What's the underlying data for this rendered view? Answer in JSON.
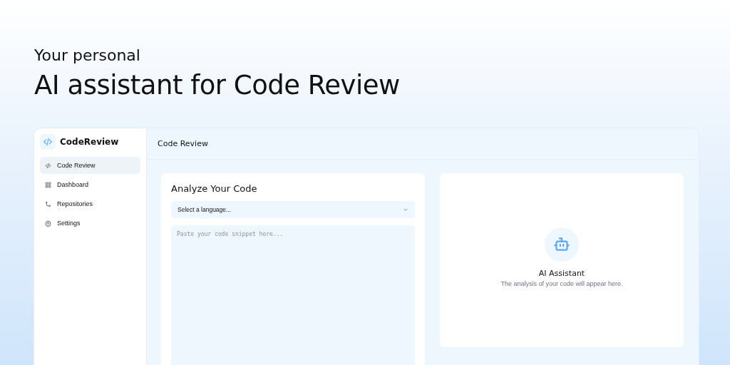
{
  "hero": {
    "subtitle": "Your personal",
    "title": "AI assistant for Code Review"
  },
  "app": {
    "brand": "CodeReview",
    "nav": [
      {
        "kind": "code",
        "label": "Code Review",
        "selected": true
      },
      {
        "kind": "grid",
        "label": "Dashboard",
        "selected": false
      },
      {
        "kind": "branch",
        "label": "Repositories",
        "selected": false
      },
      {
        "kind": "gear",
        "label": "Settings",
        "selected": false
      }
    ],
    "header": "Code Review",
    "editor": {
      "title": "Analyze Your Code",
      "language": {
        "placeholder": "Select a language..."
      },
      "code": {
        "placeholder": "Paste your code snippet here..."
      }
    },
    "assistant": {
      "title": "AI Assistant",
      "message": "The analysis of your code will appear here."
    }
  }
}
